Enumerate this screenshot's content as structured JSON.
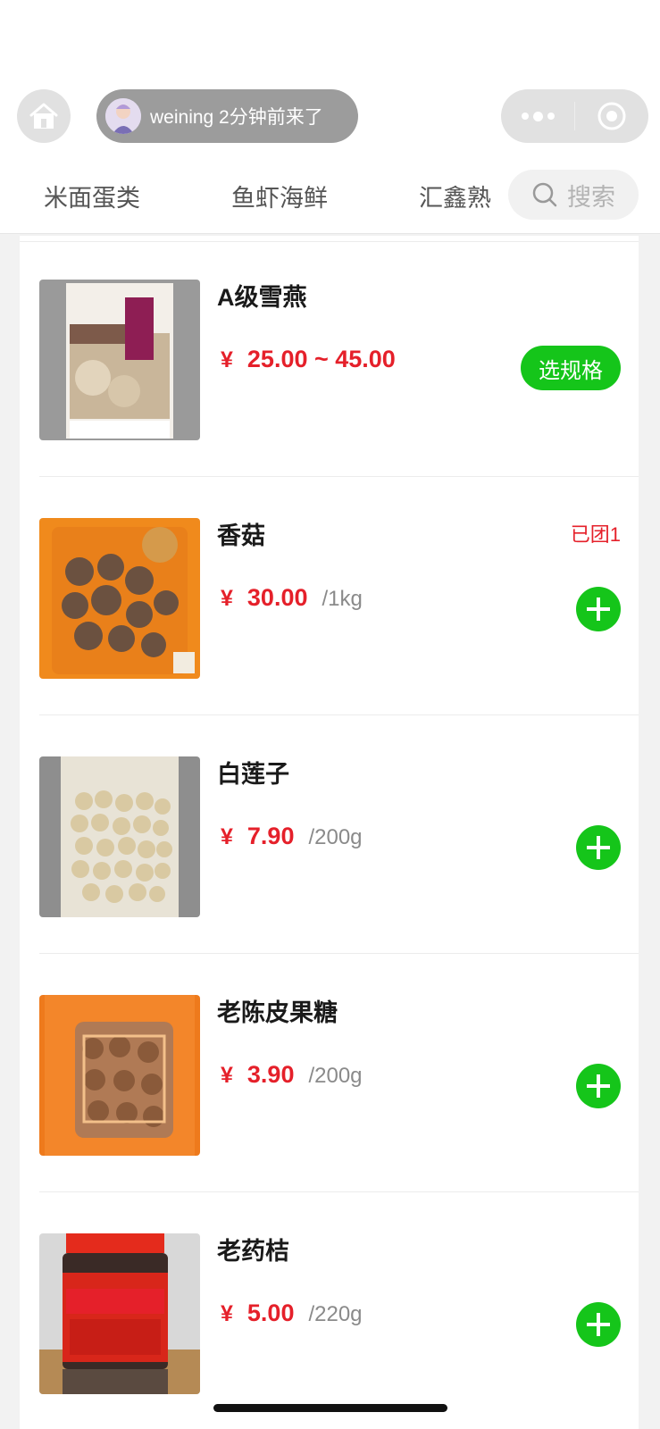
{
  "header": {
    "visitor": {
      "user": "weining",
      "text": "weining 2分钟前来了"
    },
    "tabs": [
      {
        "label": "米面蛋类"
      },
      {
        "label": "鱼虾海鲜"
      },
      {
        "label": "汇鑫熟"
      }
    ],
    "search": {
      "label": "搜索"
    }
  },
  "products": [
    {
      "name": "A级雪燕",
      "currency": "¥",
      "price": "25.00 ~ 45.00",
      "unit": "",
      "action": "选规格",
      "badge": ""
    },
    {
      "name": "香菇",
      "currency": "¥",
      "price": "30.00",
      "unit": "/1kg",
      "action": "add",
      "badge": "已团1"
    },
    {
      "name": "白莲子",
      "currency": "¥",
      "price": "7.90",
      "unit": "/200g",
      "action": "add",
      "badge": ""
    },
    {
      "name": "老陈皮果糖",
      "currency": "¥",
      "price": "3.90",
      "unit": "/200g",
      "action": "add",
      "badge": ""
    },
    {
      "name": "老药桔",
      "currency": "¥",
      "price": "5.00",
      "unit": "/220g",
      "action": "add",
      "badge": ""
    }
  ],
  "colors": {
    "accent_green": "#15c51a",
    "price_red": "#e5202a"
  }
}
